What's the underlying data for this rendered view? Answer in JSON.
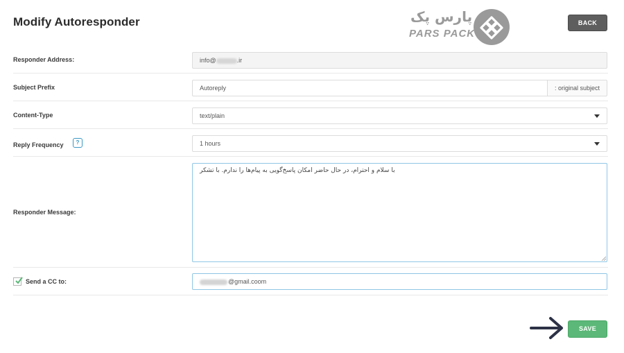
{
  "page": {
    "title": "Modify Autoresponder"
  },
  "logo": {
    "text_fa": "پارس پک",
    "text_en": "PARS PACK"
  },
  "header": {
    "back_label": "BACK"
  },
  "form": {
    "responder_address": {
      "label": "Responder Address:",
      "value_prefix": "info@",
      "value_suffix": ".ir"
    },
    "subject_prefix": {
      "label": "Subject Prefix",
      "value": "Autoreply",
      "addon": ": original subject"
    },
    "content_type": {
      "label": "Content-Type",
      "selected": "text/plain"
    },
    "reply_frequency": {
      "label": "Reply Frequency",
      "help": "?",
      "selected": "1 hours"
    },
    "responder_message": {
      "label": "Responder Message:",
      "value": "با سلام و احترام، در حال حاضر امکان پاسخ‌گویی به پیام‌ها را ندارم. با تشکر"
    },
    "send_cc": {
      "label": "Send a CC to:",
      "checked": true,
      "value_suffix": "@gmail.coom"
    }
  },
  "footer": {
    "save_label": "SAVE"
  },
  "colors": {
    "back": "#5e5e5e",
    "save": "#5cb878",
    "help": "#3a97c4",
    "focus_border": "#8fc6e6",
    "arrow": "#2d3146"
  },
  "icons": {
    "logo_mark": "diamond-logo-icon",
    "help": "help-icon",
    "select": "chevron-down-icon",
    "check": "check-icon",
    "arrow": "arrow-right-icon"
  }
}
